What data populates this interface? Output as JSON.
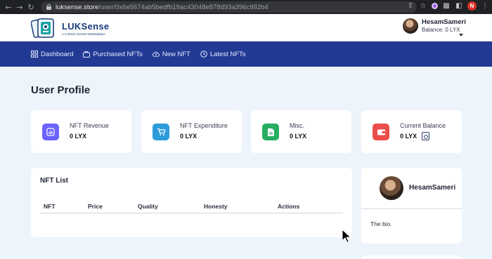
{
  "browser": {
    "url_host": "luksense.store",
    "url_path": "/user/0x6e5674ab5bedfb19ac43048e878d93a396c992b4",
    "profile_initial": "N"
  },
  "header": {
    "logo_name": "LUKSense",
    "logo_tagline": "A LUKSO License Marketplace",
    "user_name": "HesamSameri",
    "balance_text": "Balance: 0 LYX"
  },
  "nav": {
    "items": [
      {
        "label": "Dashboard",
        "icon": "grid-icon"
      },
      {
        "label": "Purchased NFTs",
        "icon": "bag-icon"
      },
      {
        "label": "New NFT",
        "icon": "cloud-upload-icon"
      },
      {
        "label": "Latest NFTs",
        "icon": "clock-icon"
      }
    ]
  },
  "page": {
    "title": "User Profile"
  },
  "stats": [
    {
      "label": "NFT Revenue",
      "value": "0 LYX",
      "color": "#6c63ff",
      "icon": "chart-icon"
    },
    {
      "label": "NFT Expenditure",
      "value": "0 LYX",
      "color": "#2d9cdb",
      "icon": "cart-icon"
    },
    {
      "label": "Misc.",
      "value": "0 LYX",
      "color": "#27ae60",
      "icon": "file-icon"
    },
    {
      "label": "Current Balance",
      "value": "0 LYX",
      "color": "#eb4d4b",
      "icon": "wallet-icon"
    }
  ],
  "nft_list": {
    "title": "NFT List",
    "columns": [
      "NFT",
      "Price",
      "Quality",
      "Honesty",
      "Actions"
    ]
  },
  "profile": {
    "name": "HesamSameri",
    "bio": "The bio."
  }
}
